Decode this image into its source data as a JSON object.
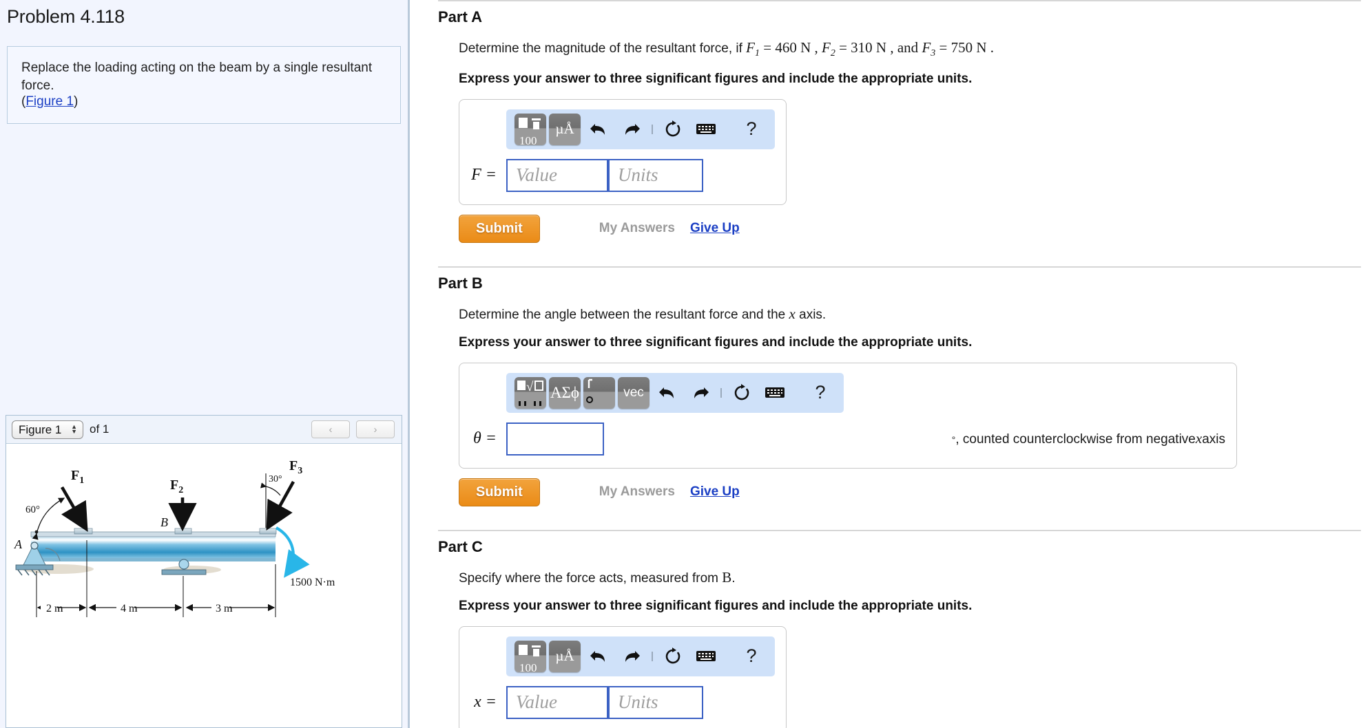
{
  "left": {
    "problem_title": "Problem 4.118",
    "problem_statement": "Replace the loading acting on the beam by a single resultant force.",
    "figure_link": "Figure 1",
    "paren_open": "(",
    "paren_close": ")",
    "figure_viewer": {
      "selected_figure": "Figure 1",
      "count_label": "of 1",
      "prev_label": "‹",
      "next_label": "›"
    }
  },
  "figure": {
    "labels": {
      "A": "A",
      "B": "B",
      "F1": "F",
      "F1_sub": "1",
      "F2": "F",
      "F2_sub": "2",
      "F3": "F",
      "F3_sub": "3",
      "angle1": "60°",
      "angle3": "30°",
      "moment": "1500 N·m",
      "dim1": "2 m",
      "dim2": "4 m",
      "dim3": "3 m"
    }
  },
  "parts": [
    {
      "id": "part-a",
      "heading": "Part A",
      "question_pre": "Determine the magnitude of the resultant force, if ",
      "q_f1": "F",
      "q_f1_sub": "1",
      "q_f1_val": " = 460 N ,  ",
      "q_f2": "F",
      "q_f2_sub": "2",
      "q_f2_val": " = 310 N , and ",
      "q_f3": "F",
      "q_f3_sub": "3",
      "q_f3_val": " = 750 N .",
      "instruction": "Express your answer to three significant figures and include the appropriate units.",
      "field_label": "F",
      "value_placeholder": "Value",
      "units_placeholder": "Units",
      "toolbar": {
        "key1": "fraction-icon",
        "key1_caption": "100",
        "key2": "µÅ",
        "undo": "↩",
        "redo": "↪",
        "reset": "↺",
        "keyboard": "keyboard-icon",
        "help": "?"
      },
      "submit": "Submit",
      "my_answers": "My Answers",
      "give_up": "Give Up"
    },
    {
      "id": "part-b",
      "heading": "Part B",
      "question_pre": "Determine the angle between the resultant force and the ",
      "question_var": "x",
      "question_post": " axis.",
      "instruction": "Express your answer to three significant figures and include the appropriate units.",
      "field_label": "θ",
      "value_placeholder": "",
      "suffix_deg": "°",
      "suffix_pre": ", counted counterclockwise from negative ",
      "suffix_var": "x",
      "suffix_post": " axis",
      "toolbar": {
        "key1": "sqrt-icon",
        "key2": "ΑΣϕ",
        "key3": "degree-icon",
        "key4": "vec",
        "undo": "↩",
        "redo": "↪",
        "reset": "↺",
        "keyboard": "keyboard-icon",
        "help": "?"
      },
      "submit": "Submit",
      "my_answers": "My Answers",
      "give_up": "Give Up"
    },
    {
      "id": "part-c",
      "heading": "Part C",
      "question_pre": "Specify where the force acts, measured from ",
      "question_var": "B",
      "question_post": ".",
      "instruction": "Express your answer to three significant figures and include the appropriate units.",
      "field_label": "x",
      "value_placeholder": "Value",
      "units_placeholder": "Units",
      "toolbar": {
        "key1": "fraction-icon",
        "key1_caption": "100",
        "key2": "µÅ",
        "undo": "↩",
        "redo": "↪",
        "reset": "↺",
        "keyboard": "keyboard-icon",
        "help": "?"
      }
    }
  ],
  "colors": {
    "panel_bg": "#f2f5fe",
    "accent_blue": "#1b3fc4",
    "submit_orange": "#ea8b17",
    "mathbar_bg": "#cfe1f9",
    "input_border": "#3b61c4"
  }
}
